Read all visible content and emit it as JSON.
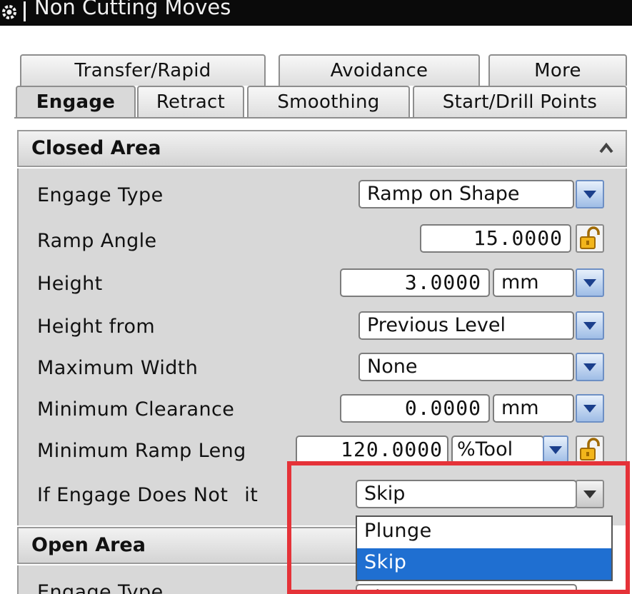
{
  "window": {
    "title": "Non Cutting Moves",
    "icon": "gear-icon"
  },
  "tabs_row1": [
    {
      "label": "Transfer/Rapid"
    },
    {
      "label": "Avoidance"
    },
    {
      "label": "More"
    }
  ],
  "tabs_row2": [
    {
      "label": "Engage",
      "active": true
    },
    {
      "label": "Retract"
    },
    {
      "label": "Smoothing"
    },
    {
      "label": "Start/Drill Points"
    }
  ],
  "closed_area": {
    "title": "Closed Area",
    "collapse_icon": "chevron-up-icon",
    "engage_type": {
      "label": "Engage Type",
      "value": "Ramp on Shape"
    },
    "ramp_angle": {
      "label": "Ramp Angle",
      "value": "15.0000",
      "icon": "lock-icon"
    },
    "height": {
      "label": "Height",
      "value": "3.0000",
      "unit": "mm"
    },
    "height_from": {
      "label": "Height from",
      "value": "Previous Level"
    },
    "maximum_width": {
      "label": "Maximum Width",
      "value": "None"
    },
    "minimum_clearance": {
      "label": "Minimum Clearance",
      "value": "0.0000",
      "unit": "mm"
    },
    "minimum_ramp_length": {
      "label": "Minimum Ramp Leng",
      "value": "120.0000",
      "unit": "%Tool",
      "icon": "lock-icon"
    },
    "if_engage_not_fit": {
      "label_left": "If Engage Does Not ",
      "label_right": "it",
      "value": "Skip",
      "options": [
        "Plunge",
        "Skip"
      ],
      "selected": "Skip"
    }
  },
  "open_area": {
    "title": "Open Area",
    "engage_type_label": "Engage Type",
    "engage_type_value": "Linear"
  },
  "colors": {
    "highlight": "#e53238",
    "selection": "#1f6fd1",
    "dropdown_accent": "#6d8fc4"
  }
}
